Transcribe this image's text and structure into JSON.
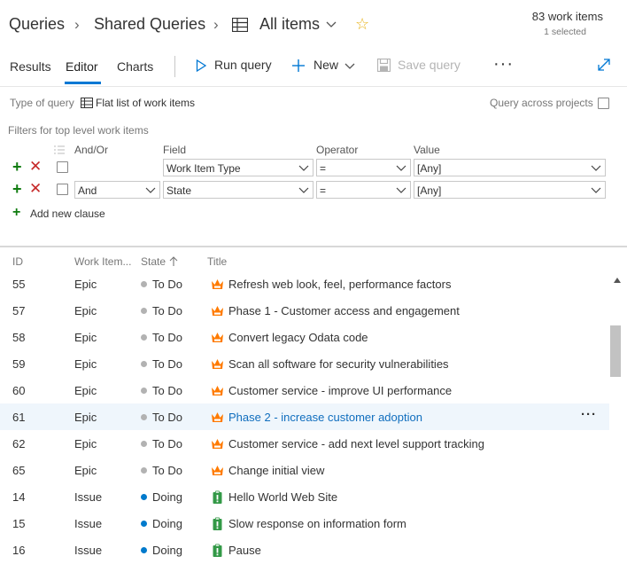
{
  "breadcrumb": {
    "queries": "Queries",
    "shared_queries": "Shared Queries",
    "current": "All items"
  },
  "summary": {
    "count": "83 work items",
    "selected": "1 selected"
  },
  "tabs": {
    "results": "Results",
    "editor": "Editor",
    "charts": "Charts"
  },
  "toolbar": {
    "run_query": "Run query",
    "new": "New",
    "save_query": "Save query",
    "more": "···"
  },
  "query_type": {
    "label": "Type of query",
    "value": "Flat list of work items",
    "across_projects_label": "Query across projects"
  },
  "filters": {
    "title": "Filters for top level work items",
    "headers": {
      "and_or": "And/Or",
      "field": "Field",
      "operator": "Operator",
      "value": "Value"
    },
    "clauses": [
      {
        "and_or": "",
        "field": "Work Item Type",
        "operator": "=",
        "value": "[Any]"
      },
      {
        "and_or": "And",
        "field": "State",
        "operator": "=",
        "value": "[Any]"
      }
    ],
    "add_clause": "Add new clause"
  },
  "results": {
    "headers": {
      "id": "ID",
      "type": "Work Item...",
      "state": "State",
      "title": "Title"
    },
    "rows": [
      {
        "id": "55",
        "type": "Epic",
        "state": "To Do",
        "title": "Refresh web look, feel, performance factors"
      },
      {
        "id": "57",
        "type": "Epic",
        "state": "To Do",
        "title": "Phase 1 - Customer access and engagement"
      },
      {
        "id": "58",
        "type": "Epic",
        "state": "To Do",
        "title": "Convert legacy Odata code"
      },
      {
        "id": "59",
        "type": "Epic",
        "state": "To Do",
        "title": "Scan all software for security vulnerabilities"
      },
      {
        "id": "60",
        "type": "Epic",
        "state": "To Do",
        "title": "Customer service - improve UI performance"
      },
      {
        "id": "61",
        "type": "Epic",
        "state": "To Do",
        "title": "Phase 2 - increase customer adoption",
        "more": "···"
      },
      {
        "id": "62",
        "type": "Epic",
        "state": "To Do",
        "title": "Customer service - add next level support tracking"
      },
      {
        "id": "65",
        "type": "Epic",
        "state": "To Do",
        "title": "Change initial view"
      },
      {
        "id": "14",
        "type": "Issue",
        "state": "Doing",
        "title": "Hello World Web Site"
      },
      {
        "id": "15",
        "type": "Issue",
        "state": "Doing",
        "title": "Slow response on information form"
      },
      {
        "id": "16",
        "type": "Issue",
        "state": "Doing",
        "title": "Pause"
      }
    ]
  },
  "colors": {
    "accent": "#0078d4",
    "epic_icon": "#ff7b00",
    "issue_icon": "#339947",
    "todo_dot": "#b2b2b2",
    "doing_dot": "#007acc",
    "add_green": "#107c10",
    "remove_red": "#c62828",
    "star": "#e8b41e"
  },
  "icons": {
    "grid": "grid-icon",
    "star": "star-icon",
    "run": "play-icon",
    "new": "plus-icon",
    "save": "save-icon",
    "expand": "expand-icon",
    "epic": "crown-icon",
    "issue": "clipboard-icon"
  }
}
